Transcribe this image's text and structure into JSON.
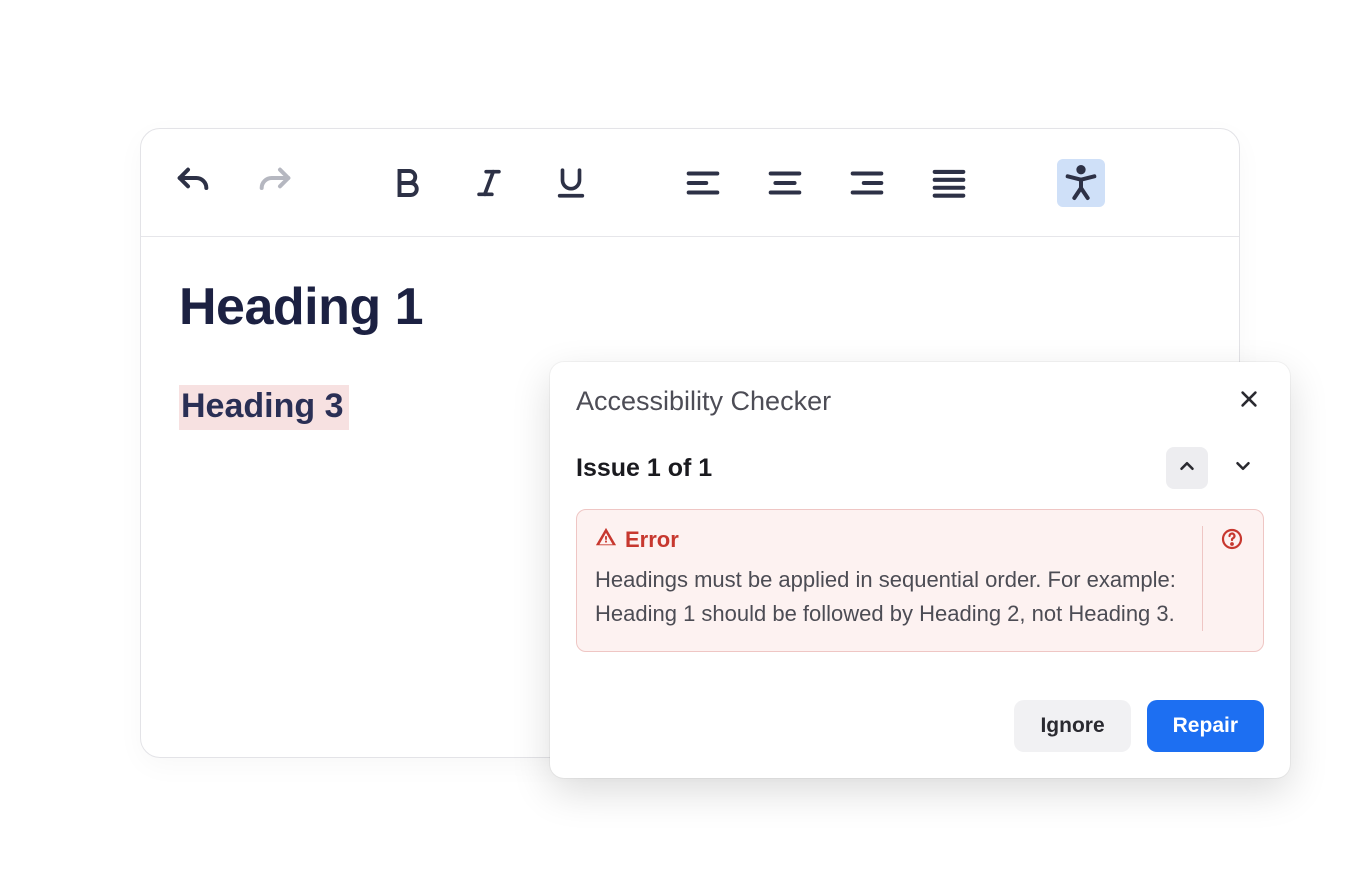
{
  "editor": {
    "content": {
      "heading1": "Heading 1",
      "heading3": "Heading 3"
    }
  },
  "checker": {
    "title": "Accessibility Checker",
    "issue_label": "Issue 1 of 1",
    "error": {
      "label": "Error",
      "description": "Headings must be applied in sequential order. For example: Heading 1 should be followed by Heading 2, not Heading 3."
    },
    "buttons": {
      "ignore": "Ignore",
      "repair": "Repair"
    }
  },
  "colors": {
    "icon_dark": "#2d3146",
    "icon_muted": "#8c8f9c",
    "error_red": "#c7382f",
    "primary_blue": "#1d6ff2",
    "highlight": "#cfe0f8"
  }
}
